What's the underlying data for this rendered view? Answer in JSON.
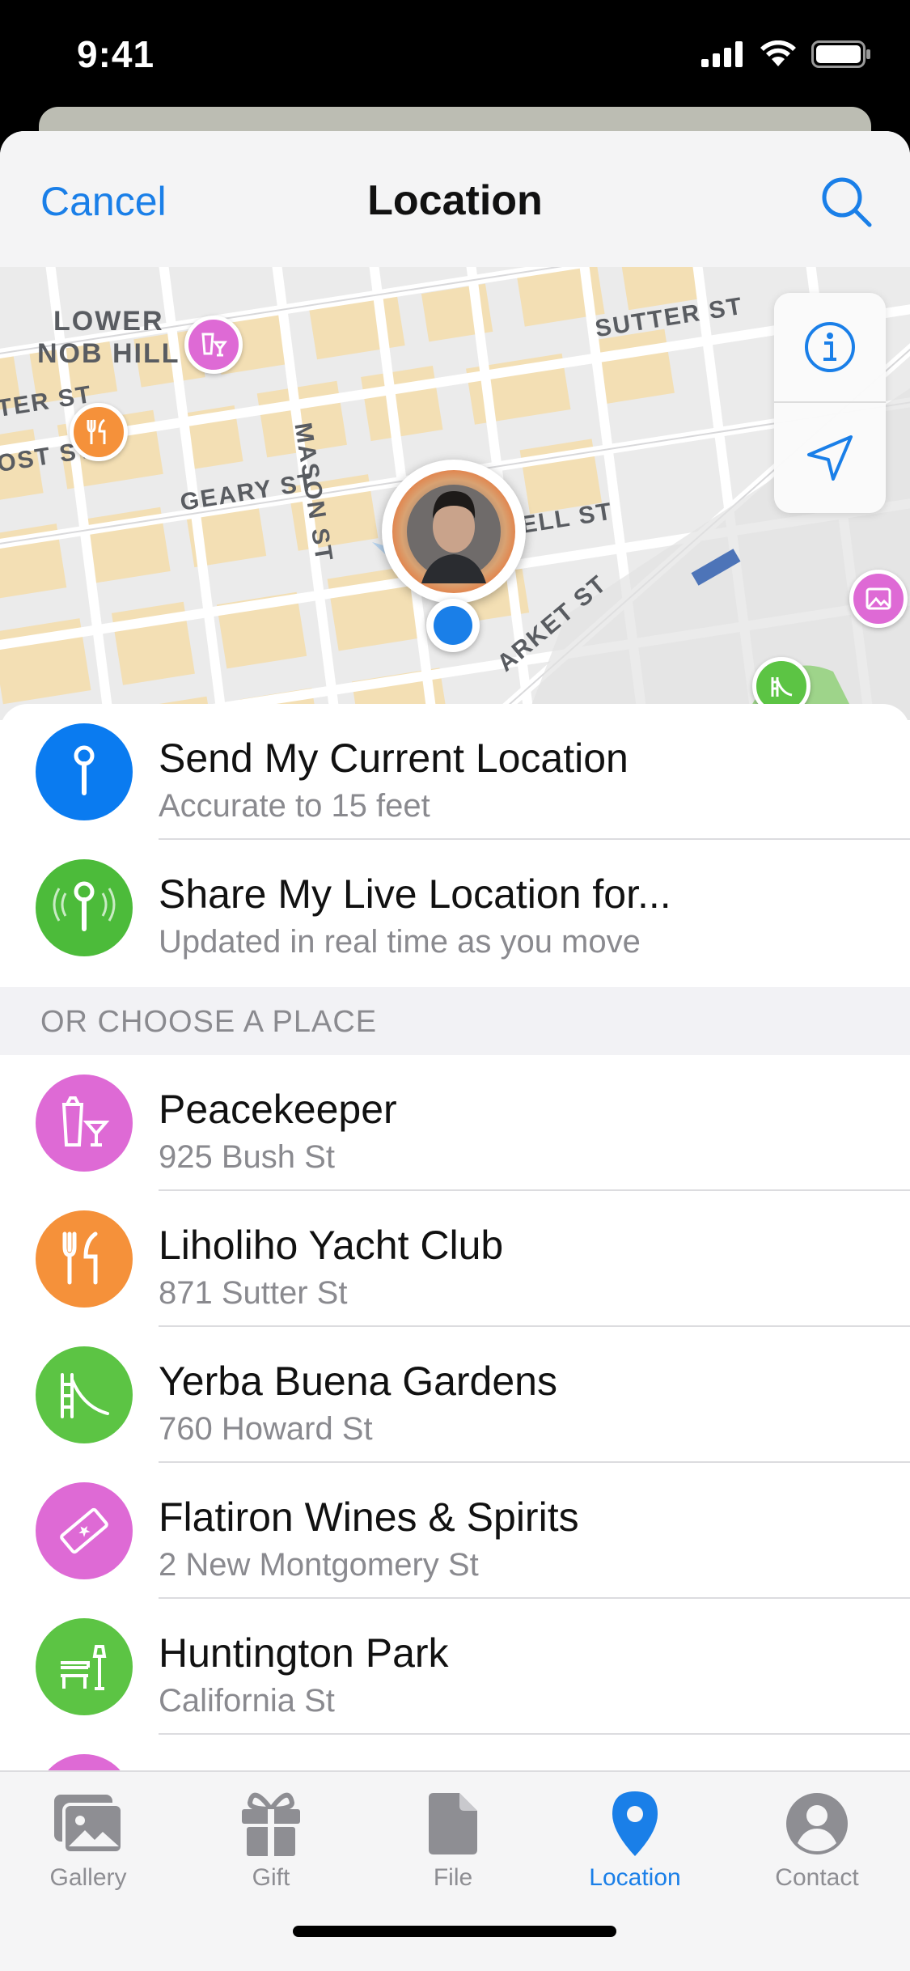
{
  "status_bar": {
    "time": "9:41"
  },
  "nav": {
    "cancel": "Cancel",
    "title": "Location"
  },
  "map": {
    "street_labels": {
      "lower_nob_hill_1": "LOWER",
      "lower_nob_hill_2": "NOB HILL",
      "sutter": "SUTTER ST",
      "mason": "MASON ST",
      "geary": "GEARY ST",
      "ofarrell": "O'FARRELL ST",
      "market": "ARKET ST",
      "post": "OST ST",
      "ter": "TER ST"
    }
  },
  "actions": [
    {
      "title": "Send My Current Location",
      "subtitle": "Accurate to 15 feet",
      "color": "#0a7bf0",
      "icon": "pin-icon"
    },
    {
      "title": "Share My Live Location for...",
      "subtitle": "Updated in real time as you move",
      "color": "#4cbb3a",
      "icon": "live-pin-icon"
    }
  ],
  "section": {
    "title": "OR CHOOSE A PLACE"
  },
  "places": [
    {
      "name": "Peacekeeper",
      "address": "925 Bush St",
      "color": "#de6ad5",
      "icon": "cocktail-icon"
    },
    {
      "name": "Liholiho Yacht Club",
      "address": "871 Sutter St",
      "color": "#f5913a",
      "icon": "fork-knife-icon"
    },
    {
      "name": "Yerba Buena Gardens",
      "address": "760 Howard St",
      "color": "#5cc444",
      "icon": "slide-icon"
    },
    {
      "name": "Flatiron Wines & Spirits",
      "address": "2 New Montgomery St",
      "color": "#de6ad5",
      "icon": "ticket-icon"
    },
    {
      "name": "Huntington Park",
      "address": "California St",
      "color": "#5cc444",
      "icon": "park-bench-icon"
    }
  ],
  "tabs": [
    {
      "label": "Gallery",
      "icon": "gallery-icon",
      "active": false
    },
    {
      "label": "Gift",
      "icon": "gift-icon",
      "active": false
    },
    {
      "label": "File",
      "icon": "file-icon",
      "active": false
    },
    {
      "label": "Location",
      "icon": "location-pin-icon",
      "active": true
    },
    {
      "label": "Contact",
      "icon": "contact-icon",
      "active": false
    }
  ],
  "colors": {
    "accent": "#1a7fe8",
    "inactive": "#8e8e93"
  }
}
